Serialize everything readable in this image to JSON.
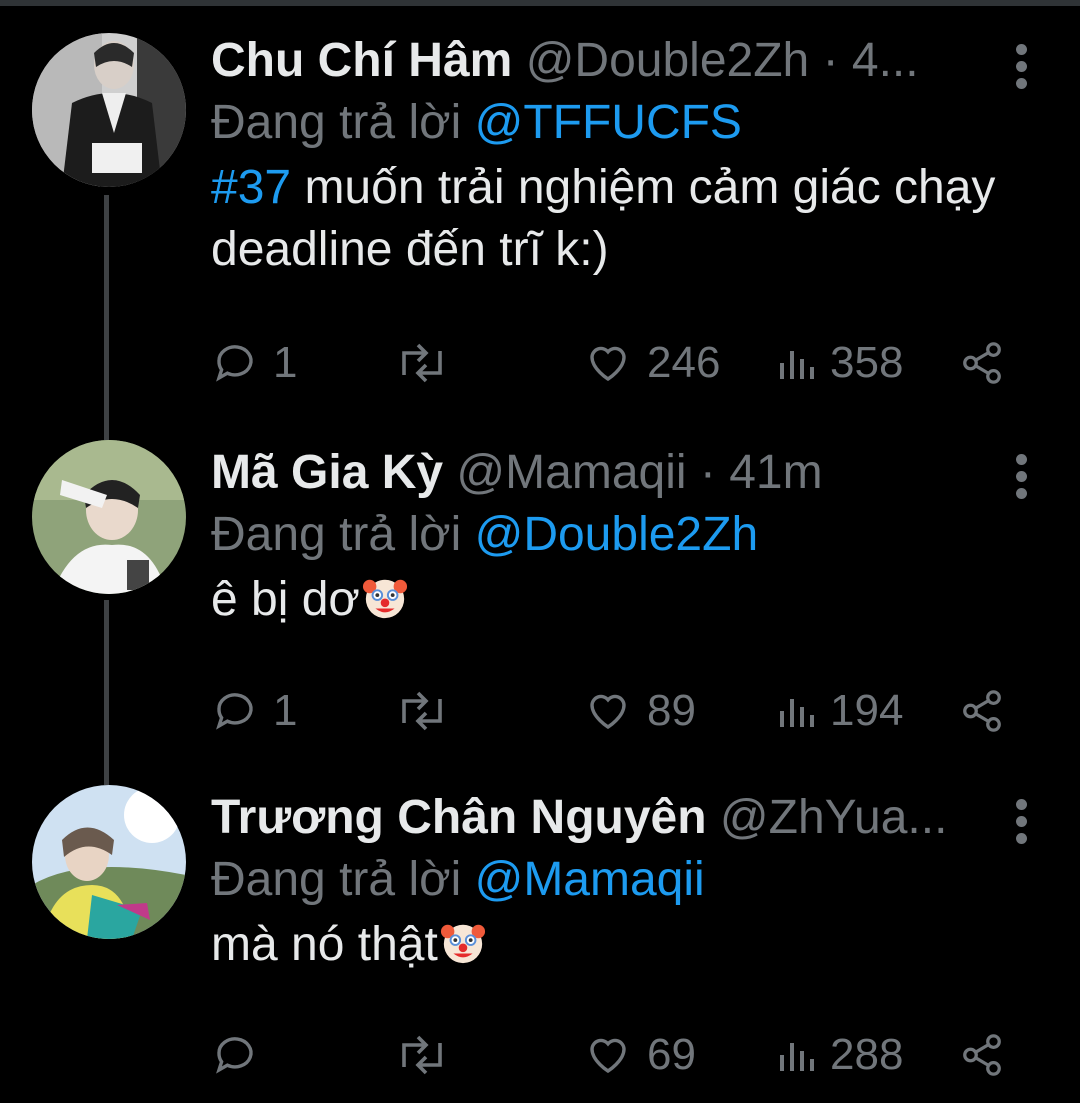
{
  "tweets": [
    {
      "name": "Chu Chí Hâm",
      "handle": "@Double2Zh",
      "time": "· 4...",
      "reply_prefix": "Đang trả lời",
      "reply_to": "@TFFUCFS",
      "hashtag": "#37",
      "text": "muốn trải nghiệm cảm giác chạy deadline đến trĩ k:)",
      "emoji": "",
      "replies": "1",
      "retweets": "",
      "likes": "246",
      "views": "358"
    },
    {
      "name": "Mã Gia Kỳ",
      "handle": "@Mamaqii",
      "time": "· 41m",
      "reply_prefix": "Đang trả lời",
      "reply_to": "@Double2Zh",
      "hashtag": "",
      "text": "ê bị dơ",
      "emoji": "clown-face",
      "replies": "1",
      "retweets": "",
      "likes": "89",
      "views": "194"
    },
    {
      "name": "Trương Chân Nguyên",
      "handle": "@ZhYua...",
      "time": "",
      "reply_prefix": "Đang trả lời",
      "reply_to": "@Mamaqii",
      "hashtag": "",
      "text": "mà nó thật",
      "emoji": "clown-face",
      "replies": "",
      "retweets": "",
      "likes": "69",
      "views": "288"
    }
  ],
  "colors": {
    "background": "#000000",
    "text": "#e7e9ea",
    "secondary": "#71767b",
    "accent": "#1d9bf0"
  },
  "icons": [
    "reply-icon",
    "retweet-icon",
    "like-icon",
    "views-icon",
    "share-icon",
    "more-icon"
  ]
}
